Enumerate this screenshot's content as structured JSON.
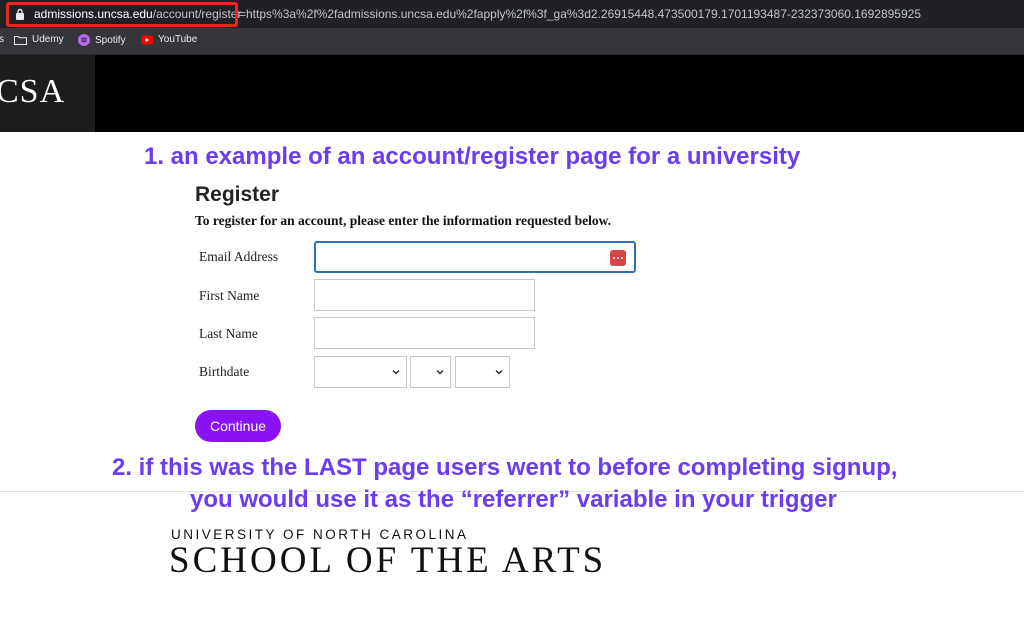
{
  "browser": {
    "url_host": "admissions.uncsa.edu",
    "url_path": "/account/register",
    "url_query": "r=https%3a%2f%2fadmissions.uncsa.edu%2fapply%2f%3f_ga%3d2.26915448.473500179.1701193487-232373060.1692895925",
    "highlight_color": "#e8281d",
    "bookmarks": [
      {
        "label": "s",
        "icon": "partial-icon"
      },
      {
        "label": "Udemy",
        "icon": "folder-icon"
      },
      {
        "label": "Spotify",
        "icon": "spotify-icon"
      },
      {
        "label": "YouTube",
        "icon": "youtube-icon"
      }
    ]
  },
  "site": {
    "logo_text": "CSA",
    "header_color": "#000000"
  },
  "annotations": {
    "note1": "1. an example of an account/register page for a university",
    "note2_line1": "2. if this was the LAST page users went to before completing signup,",
    "note2_line2": "you would use it as the “referrer” variable in your trigger",
    "color": "#6b3cf0"
  },
  "form": {
    "title": "Register",
    "instructions": "To register for an account, please enter the information requested below.",
    "fields": {
      "email_label": "Email Address",
      "email_value": "",
      "first_name_label": "First Name",
      "first_name_value": "",
      "last_name_label": "Last Name",
      "last_name_value": "",
      "birthdate_label": "Birthdate",
      "birth_month": "",
      "birth_day": "",
      "birth_year": ""
    },
    "continue_label": "Continue",
    "button_color": "#8a12f5"
  },
  "footer": {
    "small_text": "UNIVERSITY OF NORTH CAROLINA",
    "big_text": "SCHOOL OF THE ARTS"
  }
}
